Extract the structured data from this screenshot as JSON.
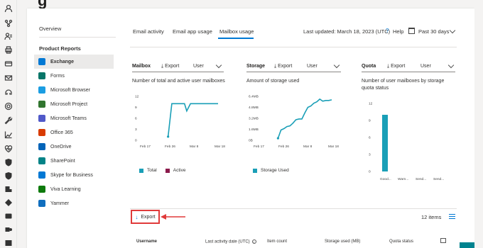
{
  "page": {
    "title_fragment": "g"
  },
  "rail_icons": [
    "person-icon",
    "org-icon",
    "user-group-icon",
    "printer-icon",
    "billing-icon",
    "mail-icon",
    "headset-icon",
    "settings-icon",
    "wrench-icon",
    "reports-icon",
    "health-icon",
    "shield-icon",
    "shield-icon-2",
    "compliance-icon",
    "endpoint-icon",
    "exchange-admin-icon",
    "teams-admin-icon",
    "sharepoint-admin-icon"
  ],
  "nav": {
    "overview": "Overview",
    "section_header": "Product Reports",
    "items": [
      {
        "label": "Exchange",
        "icon": "exchange-icon",
        "color": "#0078d4",
        "selected": true
      },
      {
        "label": "Forms",
        "icon": "forms-icon",
        "color": "#077568"
      },
      {
        "label": "Microsoft Browser",
        "icon": "edge-icon",
        "color": "#1b9de2"
      },
      {
        "label": "Microsoft Project",
        "icon": "project-icon",
        "color": "#31752f"
      },
      {
        "label": "Microsoft Teams",
        "icon": "teams-icon",
        "color": "#5059c9"
      },
      {
        "label": "Office 365",
        "icon": "office-icon",
        "color": "#d83b01"
      },
      {
        "label": "OneDrive",
        "icon": "onedrive-icon",
        "color": "#0364b8"
      },
      {
        "label": "SharePoint",
        "icon": "sharepoint-icon",
        "color": "#038387"
      },
      {
        "label": "Skype for Business",
        "icon": "skype-icon",
        "color": "#0078d4"
      },
      {
        "label": "Viva Learning",
        "icon": "viva-learning-icon",
        "color": "#0e7a0d"
      },
      {
        "label": "Yammer",
        "icon": "yammer-icon",
        "color": "#106ebe"
      }
    ]
  },
  "tabs": [
    {
      "label": "Email activity"
    },
    {
      "label": "Email app usage"
    },
    {
      "label": "Mailbox usage",
      "active": true
    }
  ],
  "header": {
    "last_updated": "Last updated: March 18, 2023 (UTC)",
    "help": "Help",
    "period": "Past 30 days"
  },
  "panels": {
    "mailbox": {
      "title": "Mailbox",
      "export": "Export",
      "select": "User",
      "description": "Number of total and active user mailboxes"
    },
    "storage": {
      "title": "Storage",
      "export": "Export",
      "select": "User",
      "description": "Amount of storage used"
    },
    "quota": {
      "title": "Quota",
      "export": "Export",
      "select": "User",
      "description": "Number of user mailboxes by storage quota status"
    }
  },
  "chart_data": [
    {
      "type": "line",
      "x": [
        "Feb 17",
        "Feb 21",
        "Feb 25",
        "Feb 26",
        "Feb 28",
        "Mar 2",
        "Mar 4",
        "Mar 5",
        "Mar 6",
        "Mar 8",
        "Mar 10",
        "Mar 12",
        "Mar 14",
        "Mar 16",
        "Mar 18"
      ],
      "x_ticks": [
        "Feb 17",
        "Feb 26",
        "Mar 8",
        "Mar 18"
      ],
      "y_ticks": [
        "12",
        "9",
        "6",
        "3",
        "0"
      ],
      "ylim": [
        0,
        12
      ],
      "series": [
        {
          "name": "Total",
          "color": "#1a9fb7",
          "values": [
            null,
            null,
            null,
            1,
            10,
            10,
            10,
            10,
            8,
            10,
            10,
            10,
            10,
            10,
            10
          ]
        },
        {
          "name": "Active",
          "color": "#8b1a4b",
          "values": []
        }
      ]
    },
    {
      "type": "line",
      "x": [
        "Feb 28",
        "Mar 1",
        "Mar 2",
        "Mar 3",
        "Mar 4",
        "Mar 5",
        "Mar 6",
        "Mar 7",
        "Mar 8",
        "Mar 9",
        "Mar 10",
        "Mar 11",
        "Mar 12",
        "Mar 13",
        "Mar 14",
        "Mar 15",
        "Mar 16",
        "Mar 17",
        "Mar 18"
      ],
      "x_ticks": [
        "Feb 17",
        "Feb 26",
        "Mar 8",
        "Mar 18"
      ],
      "y_ticks": [
        "6.4MB",
        "4.8MB",
        "3.2MB",
        "1.6MB",
        "0B"
      ],
      "ylim": [
        0,
        6.4
      ],
      "series": [
        {
          "name": "Storage Used",
          "color": "#1a9fb7",
          "values": [
            0.3,
            1.5,
            1.7,
            2.0,
            2.1,
            2.5,
            3.0,
            3.1,
            3.1,
            4.0,
            4.8,
            5.0,
            5.4,
            5.6,
            6.0,
            5.7,
            5.8,
            5.8,
            5.9
          ]
        }
      ]
    },
    {
      "type": "bar",
      "categories": [
        "Good...",
        "Warn...",
        "Send...",
        "Send..."
      ],
      "values": [
        10,
        0,
        0,
        0
      ],
      "y_ticks": [
        "12",
        "9",
        "6",
        "3",
        "0"
      ],
      "ylim": [
        0,
        12
      ],
      "color": "#1a9fb7"
    }
  ],
  "toolbar": {
    "export": "Export",
    "items": "12 items"
  },
  "table": {
    "headers": [
      "Username",
      "Last activity date (UTC)",
      "Item count",
      "Storage used (MB)",
      "Quota status"
    ]
  },
  "colors": {
    "accent": "#0078d4",
    "chart": "#1a9fb7",
    "highlight": "#e03a3a"
  }
}
